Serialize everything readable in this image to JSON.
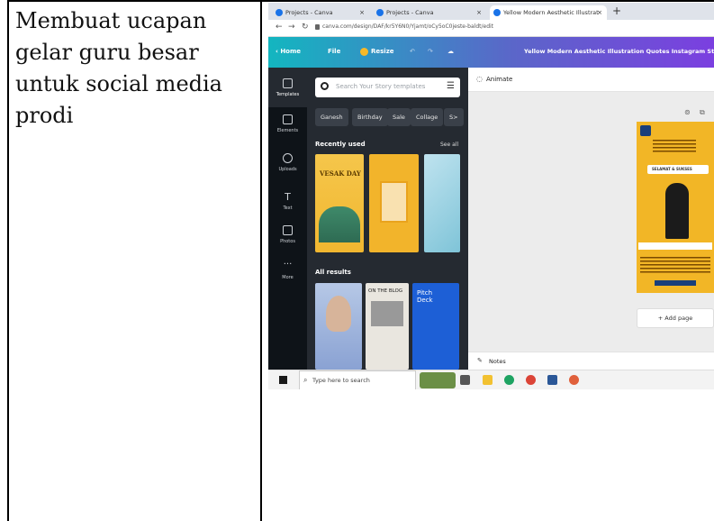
{
  "doc": {
    "cell_text": "Membuat ucapan gelar guru besar untuk social media prodi"
  },
  "browser": {
    "tabs": [
      {
        "label": "Projects - Canva",
        "active": false
      },
      {
        "label": "Projects - Canva",
        "active": false
      },
      {
        "label": "Yellow Modern Aesthetic Illustrat",
        "active": true
      }
    ],
    "new_tab": "+",
    "url": "canva.com/design/DAF/kr5Y6N0/Yjamt/oCy5oC0jeste-baldt/edit"
  },
  "canva": {
    "home": "Home",
    "file": "File",
    "resize": "Resize",
    "design_title": "Yellow Modern Aesthetic Illustration Quotes Instagram Story",
    "rail": [
      {
        "label": "Templates",
        "icon": "templates-icon"
      },
      {
        "label": "Elements",
        "icon": "elements-icon"
      },
      {
        "label": "Uploads",
        "icon": "uploads-icon"
      },
      {
        "label": "Text",
        "icon": "text-icon"
      },
      {
        "label": "Photos",
        "icon": "photos-icon"
      },
      {
        "label": "More",
        "icon": "more-icon"
      }
    ],
    "search_placeholder": "Search Your Story templates",
    "chips": [
      "Ganesh",
      "Birthday",
      "Sale",
      "Collage",
      "S>"
    ],
    "recently_used": "Recently used",
    "see_all": "See all",
    "thumb_text_vesak": "VESAK DAY",
    "all_results": "All results",
    "thumb_text_blog": "ON THE BLOG",
    "thumb_text_pitch": "Pitch Deck",
    "animate": "Animate",
    "design_banner": "SELAMAT & SUKSES",
    "add_page": "+ Add page",
    "notes": "Notes"
  },
  "taskbar": {
    "search_placeholder": "Type here to search"
  }
}
